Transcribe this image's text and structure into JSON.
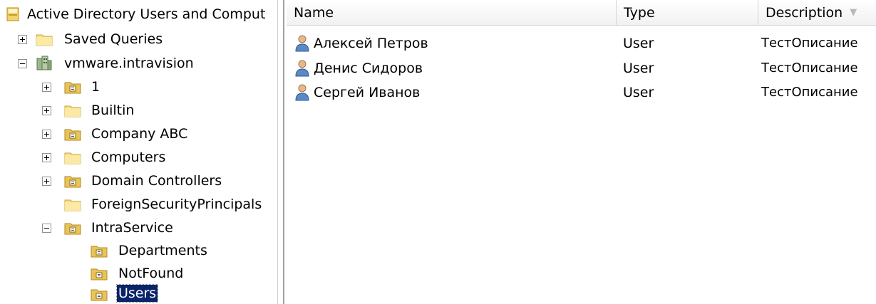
{
  "tree": {
    "root_label": "Active Directory Users and Comput",
    "items": [
      {
        "label": "Saved Queries",
        "expander": "plus",
        "icon": "folder-icon"
      },
      {
        "label": "vmware.intravision",
        "expander": "minus",
        "icon": "domain-icon"
      },
      {
        "label": "1",
        "expander": "plus",
        "icon": "ou-icon"
      },
      {
        "label": "Builtin",
        "expander": "plus",
        "icon": "folder-icon"
      },
      {
        "label": "Company ABC",
        "expander": "plus",
        "icon": "ou-icon"
      },
      {
        "label": "Computers",
        "expander": "plus",
        "icon": "folder-icon"
      },
      {
        "label": "Domain Controllers",
        "expander": "plus",
        "icon": "ou-icon"
      },
      {
        "label": "ForeignSecurityPrincipals",
        "expander": "none",
        "icon": "folder-icon"
      },
      {
        "label": "IntraService",
        "expander": "minus",
        "icon": "ou-icon"
      },
      {
        "label": "Departments",
        "expander": "none",
        "icon": "ou-icon"
      },
      {
        "label": "NotFound",
        "expander": "none",
        "icon": "ou-icon"
      },
      {
        "label": "Users",
        "expander": "none",
        "icon": "ou-icon",
        "selected": true
      }
    ]
  },
  "list": {
    "columns": [
      {
        "label": "Name"
      },
      {
        "label": "Type"
      },
      {
        "label": "Description",
        "sort_icon": "sort-down-icon"
      }
    ],
    "rows": [
      {
        "name": "Алексей Петров",
        "type": "User",
        "description": "ТестОписание",
        "icon": "user-icon"
      },
      {
        "name": "Денис Сидоров",
        "type": "User",
        "description": "ТестОписание",
        "icon": "user-icon"
      },
      {
        "name": "Сергей Иванов",
        "type": "User",
        "description": "ТестОписание",
        "icon": "user-icon"
      }
    ]
  },
  "colors": {
    "selection": "#0a246a",
    "folder": "#f5d77a",
    "header_border": "#d5d5d5"
  }
}
